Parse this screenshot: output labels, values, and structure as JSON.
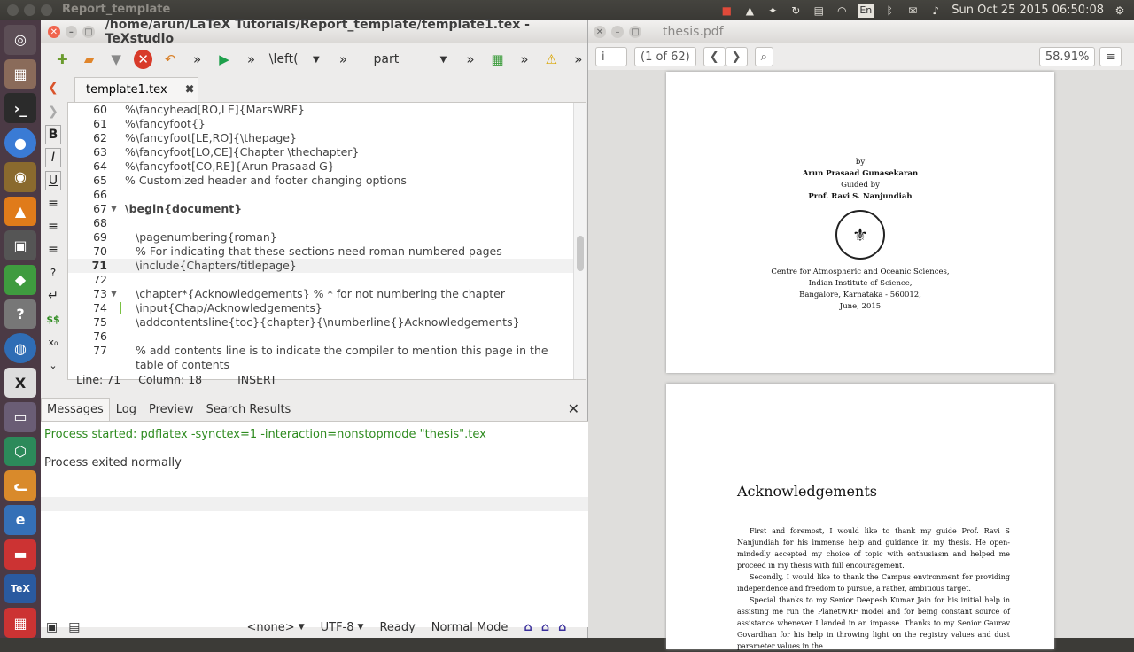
{
  "top_panel": {
    "title": "Report_template",
    "clock": "Sun Oct 25 2015 06:50:08",
    "keyboard": "En"
  },
  "launcher": {
    "items": [
      "ubuntu",
      "files",
      "terminal",
      "chrome",
      "gimp",
      "vlc",
      "media",
      "cube",
      "help",
      "browser",
      "xfig",
      "settings",
      "3d",
      "cat",
      "ie",
      "tex-app",
      "texstudio",
      "more"
    ]
  },
  "texstudio": {
    "title": "/home/arun/LaTeX Tutorials/Report_template/template1.tex - TeXstudio",
    "toolbar": {
      "left_label": "\\left(",
      "struct_label": "part"
    },
    "tab_label": "template1.tex",
    "lines": [
      {
        "n": "60",
        "t": "%\\fancyhead[RO,LE]{MarsWRF}"
      },
      {
        "n": "61",
        "t": "%\\fancyfoot{}"
      },
      {
        "n": "62",
        "t": "%\\fancyfoot[LE,RO]{\\thepage}"
      },
      {
        "n": "63",
        "t": "%\\fancyfoot[LO,CE]{Chapter \\thechapter}"
      },
      {
        "n": "64",
        "t": "%\\fancyfoot[CO,RE]{Arun Prasaad G}"
      },
      {
        "n": "65",
        "t": "% Customized header and footer changing options"
      },
      {
        "n": "66",
        "t": ""
      },
      {
        "n": "67",
        "t": "\\begin{document}"
      },
      {
        "n": "68",
        "t": ""
      },
      {
        "n": "69",
        "t": "\\pagenumbering{roman}"
      },
      {
        "n": "70",
        "t": "% For indicating that these sections need roman numbered pages"
      },
      {
        "n": "71",
        "t": "\\include{Chapters/titlepage}"
      },
      {
        "n": "72",
        "t": ""
      },
      {
        "n": "73",
        "t": "\\chapter*{Acknowledgements} % * for not numbering the chapter"
      },
      {
        "n": "74",
        "t": "\\input{Chap/Acknowledgements}"
      },
      {
        "n": "75",
        "t": "\\addcontentsline{toc}{chapter}{\\numberline{}Acknowledgements}"
      },
      {
        "n": "76",
        "t": ""
      },
      {
        "n": "77",
        "t": "% add contents line is to indicate the compiler to mention this page in the"
      },
      {
        "n": "",
        "t": "table of contents"
      }
    ],
    "status": {
      "line": "Line: 71",
      "column": "Column: 18",
      "mode": "INSERT"
    },
    "messages": {
      "tabs": [
        "Messages",
        "Log",
        "Preview",
        "Search Results"
      ],
      "line1": "Process started: pdflatex -synctex=1 -interaction=nonstopmode \"thesis\".tex",
      "line2": "Process exited normally"
    },
    "bottom": {
      "lang": "<none>",
      "encoding": "UTF-8",
      "state": "Ready",
      "mode": "Normal Mode"
    }
  },
  "pdf": {
    "title": "thesis.pdf",
    "page_input": "i",
    "page_count": "(1 of 62)",
    "zoom": "58.91%",
    "page1": {
      "by": "by",
      "author": "Arun Prasaad Gunasekaran",
      "guided": "Guided by",
      "guide": "Prof. Ravi S. Nanjundiah",
      "addr1": "Centre for Atmospheric and Oceanic Sciences,",
      "addr2": "Indian Institute of Science,",
      "addr3": "Bangalore, Karnataka - 560012,",
      "date": "June, 2015"
    },
    "page2": {
      "heading": "Acknowledgements",
      "para1": "First and foremost, I would like to thank my guide Prof. Ravi S Nanjundiah for his immense help and guidance in my thesis. He open-mindedly accepted my choice of topic with enthusiasm and helped me proceed in my thesis with full encouragement.",
      "para2": "Secondly, I would like to thank the Campus environment for providing independence and freedom to pursue, a rather, ambitious target.",
      "para3": "Special thanks to my Senior Deepesh Kumar Jain for his initial help in assisting me run the PlanetWRF model and for being constant source of assistance whenever I landed in an impasse. Thanks to my Senior Gaurav Govardhan for his help in throwing light on the registry values and dust parameter values in the"
    }
  }
}
